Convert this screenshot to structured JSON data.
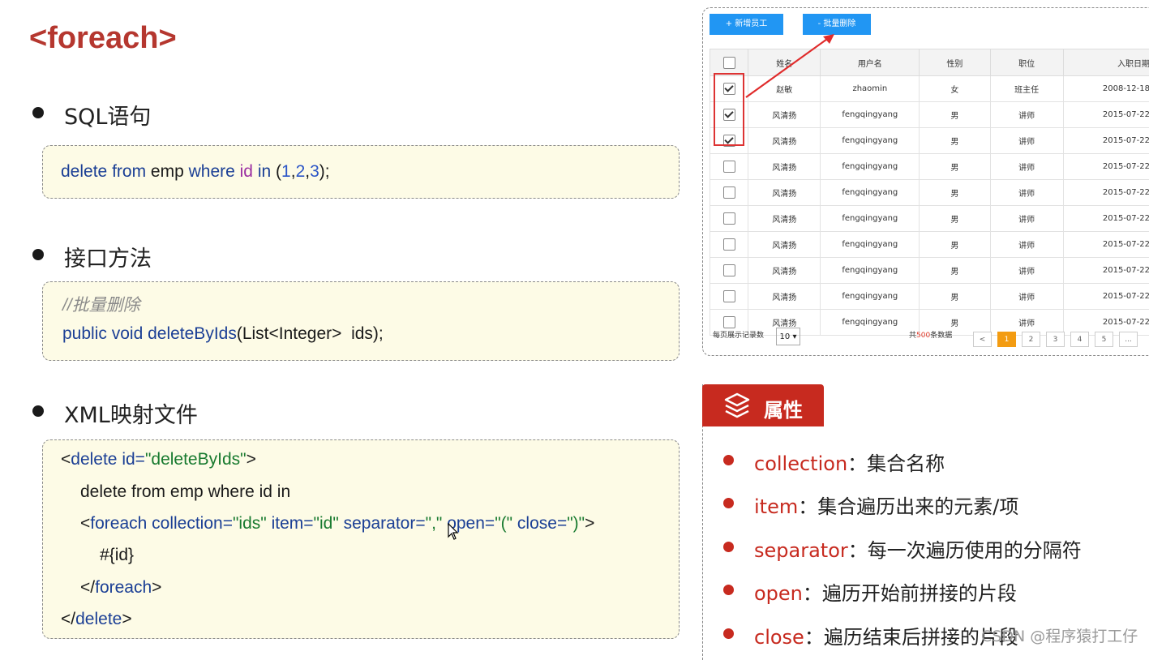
{
  "title": "<foreach>",
  "sections": [
    {
      "heading": "SQL语句"
    },
    {
      "heading": "接口方法"
    },
    {
      "heading": "XML映射文件"
    }
  ],
  "sql": {
    "kw1": "delete",
    "kw2": "from",
    "t1": " emp ",
    "kw3": "where",
    "id": "id",
    "kw4": "in",
    "p1": " (",
    "n1": "1",
    "c1": ",",
    "n2": "2",
    "c2": ",",
    "n3": "3",
    "p2": ");"
  },
  "iface": {
    "comment": "//批量删除",
    "kw1": "public",
    "kw2": "void",
    "method": "deleteByIds",
    "rest": "(List<Integer>  ids);"
  },
  "xml": {
    "l1a": "<",
    "l1b": "delete",
    "l1c": " id=",
    "l1d": "\"deleteByIds\"",
    "l1e": ">",
    "l2": "delete from emp where id in",
    "l3a": "<",
    "l3b": "foreach",
    "l3c": " collection=",
    "l3d": "\"ids\"",
    "l3e": " item=",
    "l3f": "\"id\"",
    "l3g": " separator=",
    "l3h": "\",\"",
    "l3i": " open=",
    "l3j": "\"(\"",
    "l3k": " close=",
    "l3l": "\")\"",
    "l3m": ">",
    "l4": "#{id}",
    "l5a": "</",
    "l5b": "foreach",
    "l5c": ">",
    "l6a": "</",
    "l6b": "delete",
    "l6c": ">"
  },
  "panel": {
    "add_button": "+ 新增员工",
    "delete_button": "- 批量删除",
    "columns": [
      "姓名",
      "用户名",
      "性别",
      "职位",
      "入职日期"
    ],
    "rows": [
      {
        "checked": true,
        "name": "赵敏",
        "username": "zhaomin",
        "gender": "女",
        "position": "班主任",
        "date": "2008-12-18"
      },
      {
        "checked": true,
        "name": "风清扬",
        "username": "fengqingyang",
        "gender": "男",
        "position": "讲师",
        "date": "2015-07-22"
      },
      {
        "checked": true,
        "name": "风清扬",
        "username": "fengqingyang",
        "gender": "男",
        "position": "讲师",
        "date": "2015-07-22"
      },
      {
        "checked": false,
        "name": "风清扬",
        "username": "fengqingyang",
        "gender": "男",
        "position": "讲师",
        "date": "2015-07-22"
      },
      {
        "checked": false,
        "name": "风清扬",
        "username": "fengqingyang",
        "gender": "男",
        "position": "讲师",
        "date": "2015-07-22"
      },
      {
        "checked": false,
        "name": "风清扬",
        "username": "fengqingyang",
        "gender": "男",
        "position": "讲师",
        "date": "2015-07-22"
      },
      {
        "checked": false,
        "name": "风清扬",
        "username": "fengqingyang",
        "gender": "男",
        "position": "讲师",
        "date": "2015-07-22"
      },
      {
        "checked": false,
        "name": "风清扬",
        "username": "fengqingyang",
        "gender": "男",
        "position": "讲师",
        "date": "2015-07-22"
      },
      {
        "checked": false,
        "name": "风清扬",
        "username": "fengqingyang",
        "gender": "男",
        "position": "讲师",
        "date": "2015-07-22"
      },
      {
        "checked": false,
        "name": "风清扬",
        "username": "fengqingyang",
        "gender": "男",
        "position": "讲师",
        "date": "2015-07-22"
      }
    ],
    "per_page_label": "每页展示记录数",
    "per_page_value": "10",
    "total_prefix": "共",
    "total_count": "500",
    "total_suffix": "条数据",
    "pages": [
      "<",
      "1",
      "2",
      "3",
      "4",
      "5",
      "..."
    ],
    "active_page": "1"
  },
  "properties": {
    "tab_label": "属性",
    "items": [
      {
        "key": "collection",
        "desc": "：集合名称"
      },
      {
        "key": "item",
        "desc": "：集合遍历出来的元素/项"
      },
      {
        "key": "separator",
        "desc": "：每一次遍历使用的分隔符"
      },
      {
        "key": "open",
        "desc": "：遍历开始前拼接的片段"
      },
      {
        "key": "close",
        "desc": "：遍历结束后拼接的片段"
      }
    ]
  },
  "watermark": "CSDN @程序猿打工仔",
  "colors": {
    "title": "#b5372f",
    "accent": "#c72a1f",
    "button": "#2196f3",
    "active_page": "#f39c12",
    "codebox_bg": "#fdfbe6"
  }
}
